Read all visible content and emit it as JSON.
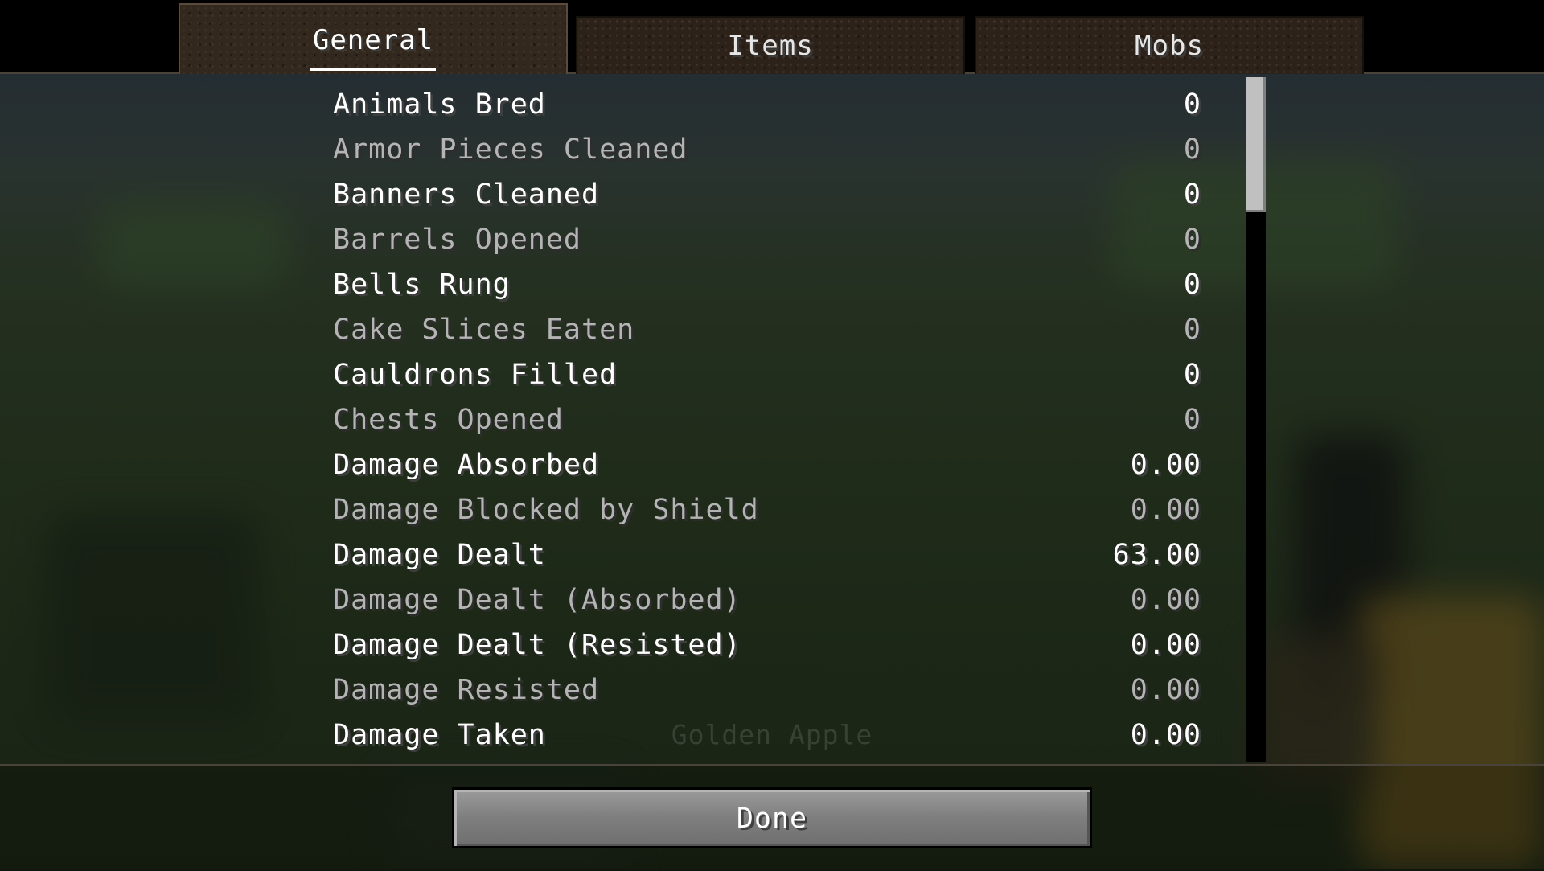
{
  "tabs": [
    {
      "label": "General",
      "active": true
    },
    {
      "label": "Items",
      "active": false
    },
    {
      "label": "Mobs",
      "active": false
    }
  ],
  "stats": [
    {
      "name": "Animals Bred",
      "value": "0"
    },
    {
      "name": "Armor Pieces Cleaned",
      "value": "0"
    },
    {
      "name": "Banners Cleaned",
      "value": "0"
    },
    {
      "name": "Barrels Opened",
      "value": "0"
    },
    {
      "name": "Bells Rung",
      "value": "0"
    },
    {
      "name": "Cake Slices Eaten",
      "value": "0"
    },
    {
      "name": "Cauldrons Filled",
      "value": "0"
    },
    {
      "name": "Chests Opened",
      "value": "0"
    },
    {
      "name": "Damage Absorbed",
      "value": "0.00"
    },
    {
      "name": "Damage Blocked by Shield",
      "value": "0.00"
    },
    {
      "name": "Damage Dealt",
      "value": "63.00"
    },
    {
      "name": "Damage Dealt (Absorbed)",
      "value": "0.00"
    },
    {
      "name": "Damage Dealt (Resisted)",
      "value": "0.00"
    },
    {
      "name": "Damage Resisted",
      "value": "0.00"
    },
    {
      "name": "Damage Taken",
      "value": "0.00"
    }
  ],
  "background_item_text": "Golden Apple",
  "done_label": "Done",
  "colors": {
    "bright_text": "#ffffff",
    "dim_text": "#b4b4b4",
    "tab_dirt": "#2c221a",
    "button_gray": "#8a8a8a"
  }
}
